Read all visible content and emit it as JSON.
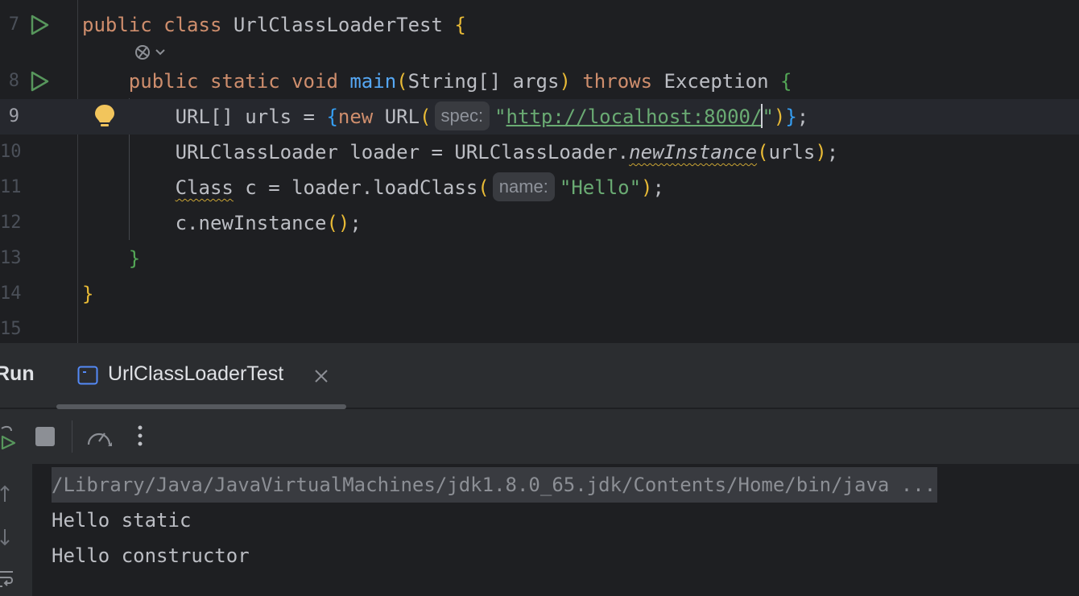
{
  "editor": {
    "lines": [
      {
        "num": "7"
      },
      {
        "num": ""
      },
      {
        "num": "8"
      },
      {
        "num": "9"
      },
      {
        "num": "10"
      },
      {
        "num": "11"
      },
      {
        "num": "12"
      },
      {
        "num": "13"
      },
      {
        "num": "14"
      },
      {
        "num": "15"
      }
    ],
    "code": {
      "l7": {
        "kw1": "public",
        "kw2": "class",
        "name": "UrlClassLoaderTest",
        "brace": "{"
      },
      "l8": {
        "kw1": "public",
        "kw2": "static",
        "kw3": "void",
        "fn": "main",
        "open": "(",
        "params": "String[] args",
        "close": ")",
        "kw4": "throws",
        "exc": "Exception",
        "brace": "{"
      },
      "l9": {
        "pre": "URL[] urls = ",
        "brace": "{",
        "kw": "new",
        "ctor": " URL",
        "open": "(",
        "hint": "spec:",
        "q1": "\"",
        "url_a": "http://localhost:8000",
        "url_b": "/",
        "q2": "\"",
        "close": ")",
        "brace2": "}",
        "semi": ";"
      },
      "l10": {
        "pre": "URLClassLoader loader = URLClassLoader.",
        "method": "newInstance",
        "open": "(",
        "arg": "urls",
        "close": ")",
        "semi": ";"
      },
      "l11": {
        "type": "Class",
        "mid": " c = loader.loadClass",
        "open": "(",
        "hint": "name:",
        "str": "\"Hello\"",
        "close": ")",
        "semi": ";"
      },
      "l12": {
        "pre": "c.newInstance",
        "open": "(",
        "close": ")",
        "semi": ";"
      },
      "l13": {
        "brace": "}"
      },
      "l14": {
        "brace": "}"
      }
    }
  },
  "run_panel": {
    "title": "Run",
    "tab_label": "UrlClassLoaderTest",
    "console": [
      "/Library/Java/JavaVirtualMachines/jdk1.8.0_65.jdk/Contents/Home/bin/java ...",
      "Hello static",
      "Hello constructor"
    ]
  },
  "icons": {
    "run_gutter": "run-play-icon",
    "bulb": "lightbulb-icon",
    "rerun": "rerun-icon",
    "stop": "stop-icon",
    "profiler": "speedometer-icon",
    "more": "more-vertical-icon"
  },
  "colors": {
    "keyword": "#cf8e6d",
    "function": "#56a8f5",
    "string": "#6aab73",
    "run_green": "#57965c",
    "bulb_yellow": "#f2c55c"
  }
}
